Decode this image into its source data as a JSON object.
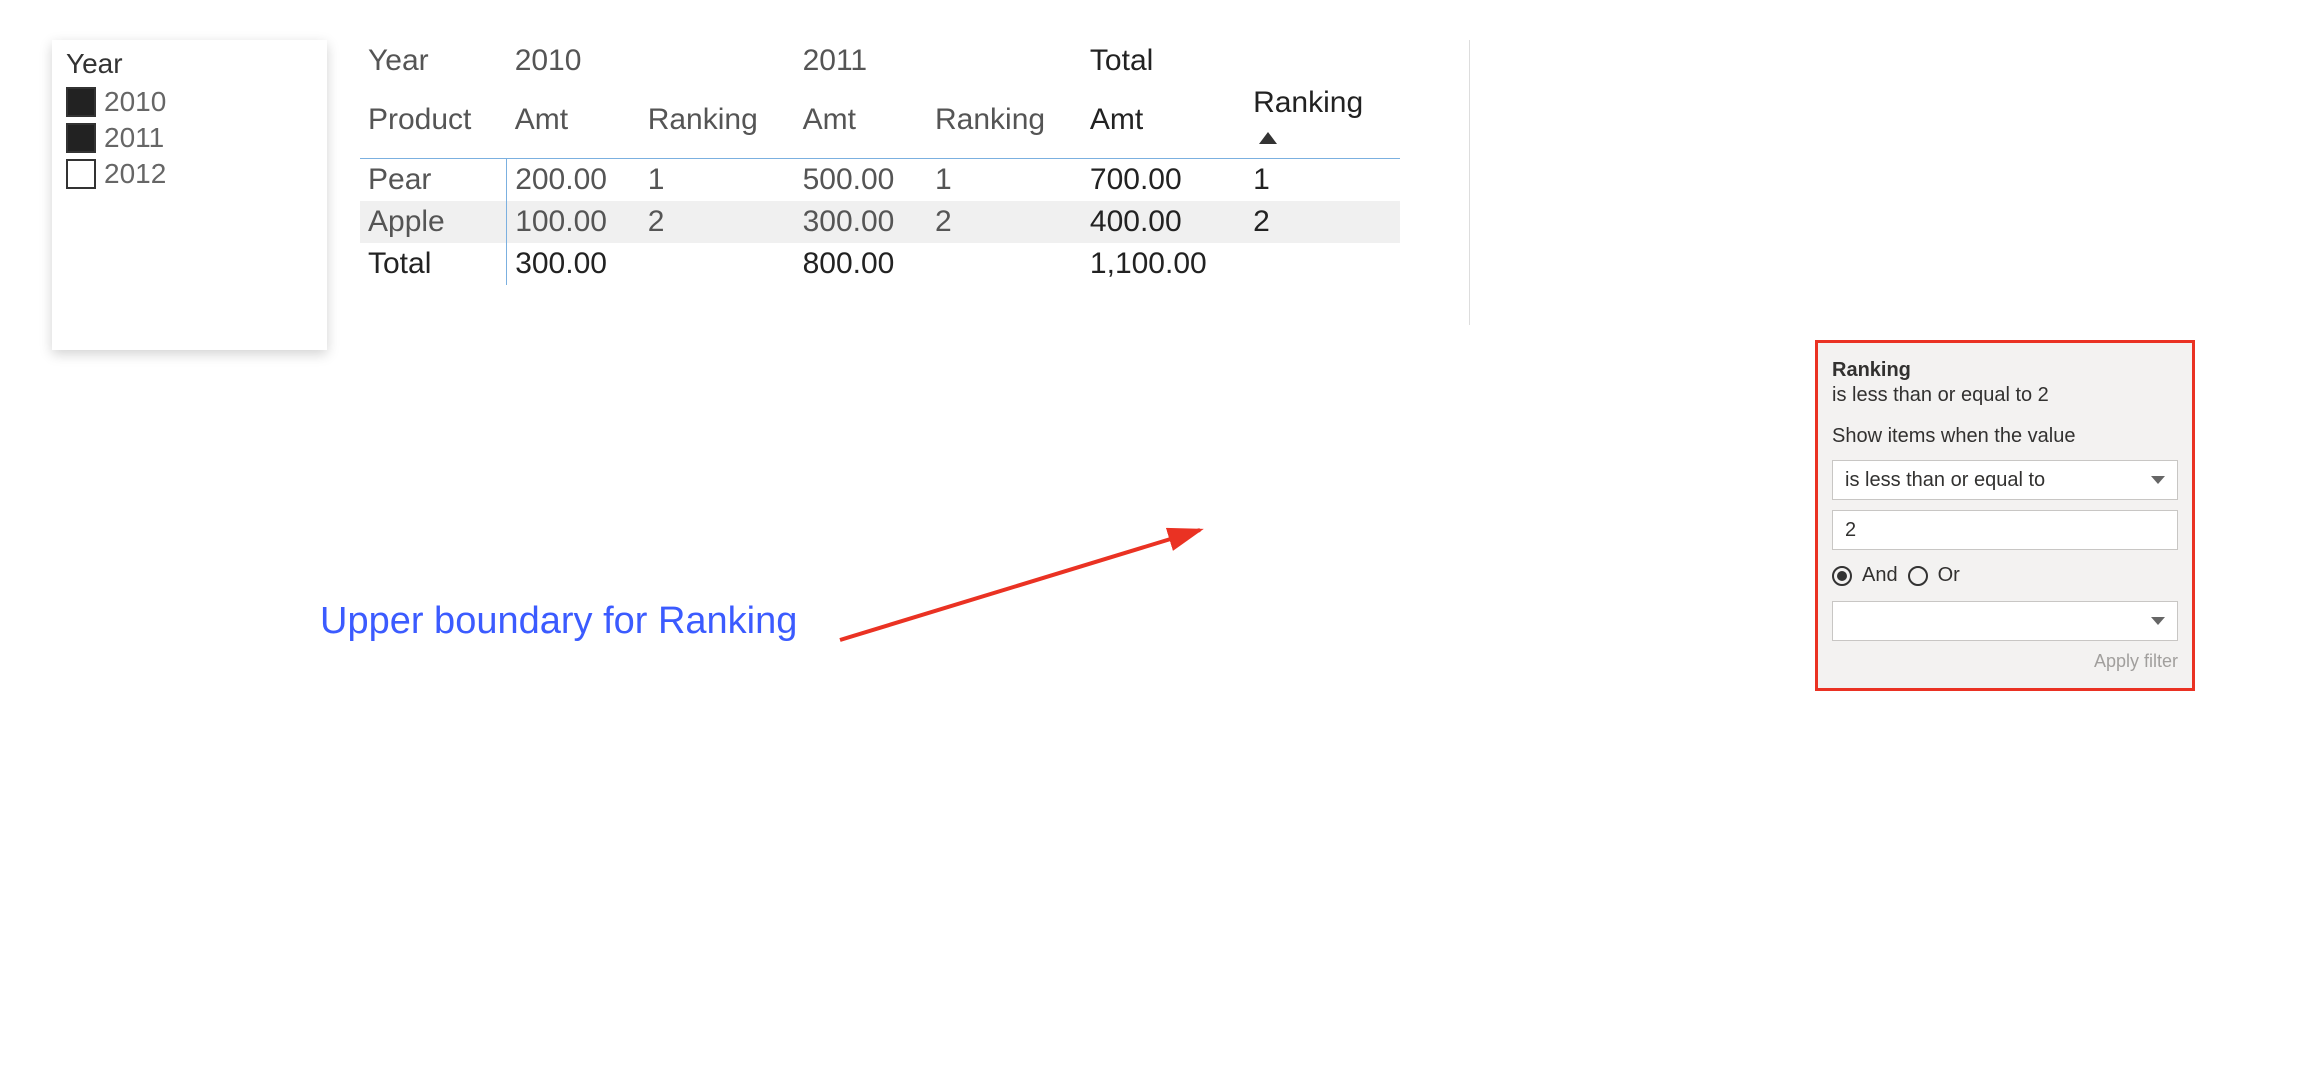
{
  "slicer": {
    "title": "Year",
    "items": [
      {
        "label": "2010",
        "checked": true
      },
      {
        "label": "2011",
        "checked": true
      },
      {
        "label": "2012",
        "checked": false
      }
    ]
  },
  "matrix": {
    "row_field": "Year",
    "col_field": "Product",
    "headers": {
      "year_groups": [
        "2010",
        "2011"
      ],
      "total": "Total",
      "measures": [
        "Amt",
        "Ranking"
      ],
      "total_measures": [
        "Amt",
        "Ranking"
      ]
    },
    "rows": [
      {
        "product": "Pear",
        "y2010_amt": "200.00",
        "y2010_rank": "1",
        "y2011_amt": "500.00",
        "y2011_rank": "1",
        "total_amt": "700.00",
        "total_rank": "1"
      },
      {
        "product": "Apple",
        "y2010_amt": "100.00",
        "y2010_rank": "2",
        "y2011_amt": "300.00",
        "y2011_rank": "2",
        "total_amt": "400.00",
        "total_rank": "2"
      }
    ],
    "totals": {
      "label": "Total",
      "y2010_amt": "300.00",
      "y2011_amt": "800.00",
      "total_amt": "1,100.00"
    }
  },
  "filter_panel": {
    "heading": "Ranking",
    "summary": "is less than or equal to 2",
    "label": "Show items when the value",
    "operator1": "is less than or equal to",
    "value1": "2",
    "logic": {
      "and": "And",
      "or": "Or",
      "selected": "and"
    },
    "operator2": "",
    "apply": "Apply filter"
  },
  "annotation": "Upper boundary for Ranking"
}
